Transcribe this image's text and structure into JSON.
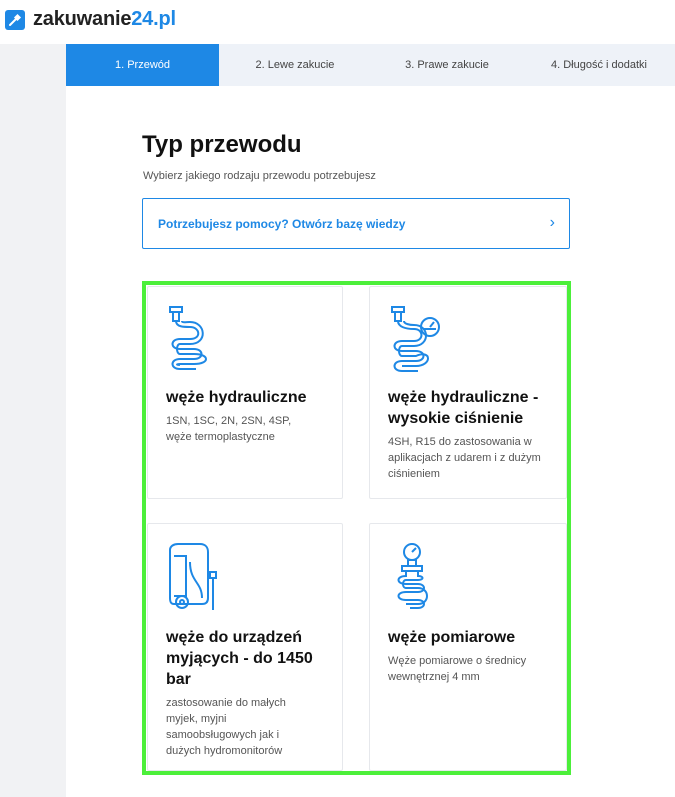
{
  "header": {
    "logo_text": "zakuwanie",
    "logo_accent": "24.pl",
    "brand_color": "#1e88e5"
  },
  "steps": [
    {
      "label": "1. Przewód",
      "active": true
    },
    {
      "label": "2. Lewe zakucie",
      "active": false
    },
    {
      "label": "3. Prawe zakucie",
      "active": false
    },
    {
      "label": "4. Długość i dodatki",
      "active": false
    }
  ],
  "main": {
    "title": "Typ przewodu",
    "subtitle": "Wybierz jakiego rodzaju przewodu potrzebujesz",
    "help_label": "Potrzebujesz pomocy? Otwórz bazę wiedzy",
    "help_arrow": "›"
  },
  "highlight_color": "#4cef3a",
  "cards": [
    {
      "icon": "hose-icon",
      "title": "węże hydrauliczne",
      "description": "1SN, 1SC, 2N, 2SN, 4SP, węże termoplastyczne"
    },
    {
      "icon": "hose-pressure-gauge-icon",
      "title": "węże hydrauliczne - wysokie ciśnienie",
      "description": "4SH, R15 do zastosowania w aplikacjach z udarem i z dużym ciśnieniem"
    },
    {
      "icon": "pressure-washer-icon",
      "title": "węże do urządzeń myjących - do 1450 bar",
      "description": "zastosowanie do małych myjek, myjni samoobsługowych jak i dużych hydromonitorów"
    },
    {
      "icon": "gauge-hose-icon",
      "title": "węże pomiarowe",
      "description": "Węże pomiarowe o średnicy wewnętrznej 4 mm"
    }
  ]
}
